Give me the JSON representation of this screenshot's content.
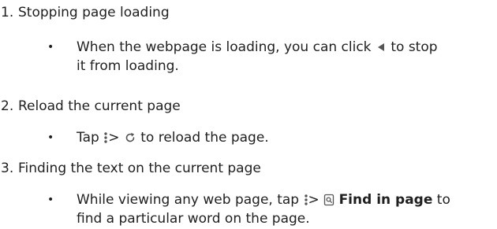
{
  "steps": [
    {
      "number": "1.",
      "title": "Stopping page loading",
      "detail": {
        "pre": "When the webpage is loading, you can click",
        "icon": "stop-loading-icon",
        "post_1": "to stop",
        "post_2": "it from loading."
      }
    },
    {
      "number": "2.",
      "title": "Reload the current page",
      "detail": {
        "pre": "Tap",
        "icon_menu": "more-menu-icon",
        "sep": ">",
        "icon": "reload-icon",
        "post": "to reload the page."
      }
    },
    {
      "number": "3.",
      "title": "Finding the text on the current page",
      "detail": {
        "pre": "While viewing any web page, tap",
        "icon_menu": "more-menu-icon",
        "sep": ">",
        "icon": "find-in-page-icon",
        "bold": "Find in page",
        "post_1": "to",
        "post_2": "find a particular word on the page."
      }
    }
  ],
  "bullet_char": "•",
  "colors": {
    "text": "#1f1f1f",
    "icon": "#555555"
  }
}
